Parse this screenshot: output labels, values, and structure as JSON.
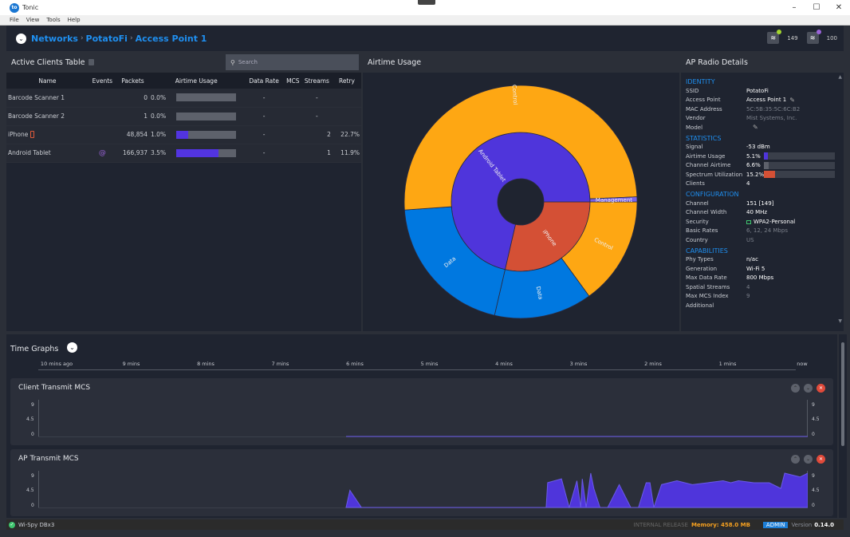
{
  "window": {
    "title": "Tonic",
    "logo_text": "to",
    "controls": {
      "minimize": "–",
      "maximize": "☐",
      "close": "✕"
    }
  },
  "menu": [
    "File",
    "View",
    "Tools",
    "Help"
  ],
  "breadcrumb": {
    "items": [
      "Networks",
      "PotatoFi",
      "Access Point 1"
    ],
    "separator": "›"
  },
  "radios": [
    {
      "count": "149",
      "dot_color": "#a3d62e"
    },
    {
      "count": "100",
      "dot_color": "#9a63d8"
    }
  ],
  "clients_table": {
    "title": "Active Clients Table",
    "search_placeholder": "Search",
    "columns": [
      "Name",
      "Events",
      "Packets",
      "Airtime Usage",
      "Data Rate",
      "MCS",
      "Streams",
      "Retry"
    ],
    "rows": [
      {
        "name": "Barcode Scanner 1",
        "device_icon": "",
        "events": "",
        "packets": "0",
        "airtime_pct": "0.0%",
        "airtime_fraction": 0.0,
        "data_rate": "-",
        "mcs": "",
        "streams": "-",
        "retry": ""
      },
      {
        "name": "Barcode Scanner 2",
        "device_icon": "",
        "events": "",
        "packets": "1",
        "airtime_pct": "0.0%",
        "airtime_fraction": 0.0,
        "data_rate": "-",
        "mcs": "",
        "streams": "-",
        "retry": ""
      },
      {
        "name": "iPhone",
        "device_icon": "phone-icon",
        "events": "",
        "packets": "48,854",
        "airtime_pct": "1.0%",
        "airtime_fraction": 0.2,
        "data_rate": "-",
        "mcs": "",
        "streams": "2",
        "retry": "22.7%"
      },
      {
        "name": "Android Tablet",
        "device_icon": "",
        "events": "@",
        "packets": "166,937",
        "airtime_pct": "3.5%",
        "airtime_fraction": 0.7,
        "data_rate": "-",
        "mcs": "",
        "streams": "1",
        "retry": "11.9%"
      }
    ]
  },
  "airtime_panel": {
    "title": "Airtime Usage"
  },
  "chart_data": [
    {
      "type": "sunburst",
      "title": "Airtime Usage",
      "colors": {
        "Android Tablet": "#4f35db",
        "iPhone": "#d45035",
        "Control": "#fea713",
        "Data": "#0078e0",
        "Management": "#7a63e8"
      },
      "series": [
        {
          "name": "Android Tablet",
          "children": [
            {
              "name": "Management",
              "value": 2.5
            },
            {
              "name": "Control",
              "value": 181.5
            },
            {
              "name": "Data",
              "value": 73
            }
          ]
        },
        {
          "name": "iPhone",
          "children": [
            {
              "name": "Control",
              "value": 54
            },
            {
              "name": "Data",
              "value": 49
            }
          ]
        }
      ]
    },
    {
      "type": "area",
      "title": "Client Transmit MCS",
      "ylim": [
        0,
        9
      ],
      "yticks": [
        "9",
        "4.5",
        "0"
      ],
      "xlabels": [
        "10 mins ago",
        "9 mins",
        "8 mins",
        "7 mins",
        "6 mins",
        "5 mins",
        "4 mins",
        "3 mins",
        "2 mins",
        "1 mins",
        "now"
      ],
      "x_minutes_ago": [
        6.0,
        0
      ],
      "values": [
        0,
        0
      ]
    },
    {
      "type": "area",
      "title": "AP Transmit MCS",
      "ylim": [
        0,
        9
      ],
      "yticks": [
        "9",
        "4.5",
        "0"
      ],
      "x_minutes_ago": [
        6.0,
        5.95,
        5.8,
        3.4,
        3.38,
        3.2,
        3.1,
        3.0,
        2.95,
        2.93,
        2.88,
        2.82,
        2.78,
        2.7,
        2.6,
        2.45,
        2.3,
        2.2,
        2.1,
        2.05,
        2.0,
        1.9,
        1.7,
        1.5,
        1.3,
        1.1,
        1.0,
        0.9,
        0.7,
        0.5,
        0.35,
        0.3,
        0.1,
        0.0
      ],
      "values": [
        0,
        4.5,
        0,
        0,
        6.5,
        7.5,
        0,
        7,
        0,
        7.5,
        0,
        9,
        5,
        0,
        0,
        6,
        0,
        0,
        6.5,
        6.5,
        0,
        6,
        7,
        6,
        6.5,
        7,
        6.5,
        7,
        6.5,
        6.5,
        5,
        9,
        8,
        9
      ]
    }
  ],
  "radio_details": {
    "title": "AP Radio Details",
    "identity": {
      "label": "IDENTITY",
      "ssid_label": "SSID",
      "ssid": "PotatoFi",
      "ap_label": "Access Point",
      "ap": "Access Point 1",
      "mac_label": "MAC Address",
      "mac": "5C:5B:35:5C:6C:B2",
      "vendor_label": "Vendor",
      "vendor": "Mist Systems, Inc.",
      "model_label": "Model",
      "model": ""
    },
    "statistics": {
      "label": "STATISTICS",
      "signal_label": "Signal",
      "signal": "-53 dBm",
      "airtime_label": "Airtime Usage",
      "airtime": "5.1%",
      "airtime_fraction": 0.051,
      "airtime_color": "#4f35db",
      "channel_airtime_label": "Channel Airtime",
      "channel_airtime": "6.6%",
      "channel_airtime_fraction": 0.066,
      "channel_airtime_color": "#5d616b",
      "spectrum_label": "Spectrum Utilization",
      "spectrum": "15.2%",
      "spectrum_fraction": 0.152,
      "spectrum_color": "#d45035",
      "clients_label": "Clients",
      "clients": "4"
    },
    "configuration": {
      "label": "CONFIGURATION",
      "channel_label": "Channel",
      "channel": "151 [149]",
      "width_label": "Channel Width",
      "width": "40 MHz",
      "security_label": "Security",
      "security": "WPA2-Personal",
      "basic_rates_label": "Basic Rates",
      "basic_rates": "6, 12, 24 Mbps",
      "country_label": "Country",
      "country": "US"
    },
    "capabilities": {
      "label": "CAPABILITIES",
      "phy_label": "Phy Types",
      "phy": "n/ac",
      "gen_label": "Generation",
      "gen": "Wi-Fi 5",
      "max_rate_label": "Max Data Rate",
      "max_rate": "800 Mbps",
      "streams_label": "Spatial Streams",
      "streams": "4",
      "max_mcs_label": "Max MCS Index",
      "max_mcs": "9",
      "additional_label": "Additional",
      "additional": ""
    }
  },
  "time_graphs": {
    "title": "Time Graphs",
    "ticks": [
      "10 mins ago",
      "9 mins",
      "8 mins",
      "7 mins",
      "6 mins",
      "5 mins",
      "4 mins",
      "3 mins",
      "2 mins",
      "1 mins",
      "now"
    ],
    "graph1_title": "Client Transmit MCS",
    "graph2_title": "AP Transmit MCS",
    "yticks": [
      "9",
      "4.5",
      "0"
    ],
    "series_color": "#4f35db"
  },
  "status": {
    "device": "Wi-Spy DBx3",
    "internal": "INTERNAL RELEASE",
    "memory": "Memory: 458.0 MB",
    "role": "ADMIN",
    "version_label": "Version",
    "version": "0.14.0"
  }
}
